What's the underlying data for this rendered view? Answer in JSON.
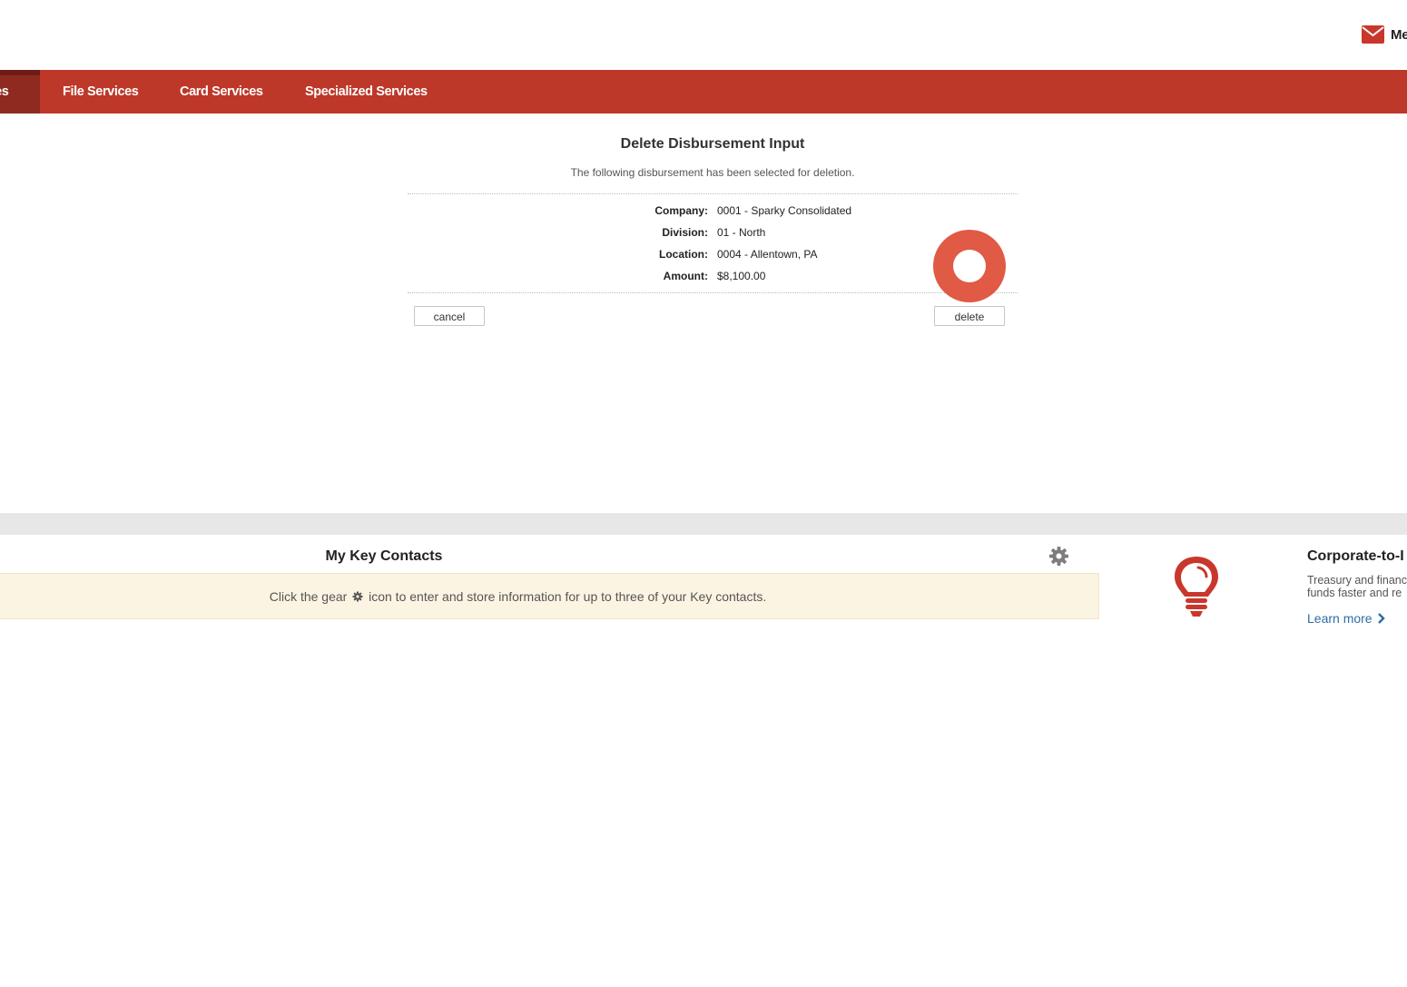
{
  "header": {
    "mail_label": "Me"
  },
  "nav": {
    "items": [
      {
        "label": "bles",
        "active": true
      },
      {
        "label": "File Services",
        "active": false
      },
      {
        "label": "Card Services",
        "active": false
      },
      {
        "label": "Specialized Services",
        "active": false
      }
    ]
  },
  "panel": {
    "title": "Delete Disbursement Input",
    "subtitle": "The following disbursement has been selected for deletion.",
    "details": [
      {
        "label": "Company:",
        "value": "0001 - Sparky Consolidated"
      },
      {
        "label": "Division:",
        "value": "01 - North"
      },
      {
        "label": "Location:",
        "value": "0004 - Allentown, PA"
      },
      {
        "label": "Amount:",
        "value": "$8,100.00"
      }
    ],
    "cancel_label": "cancel",
    "delete_label": "delete"
  },
  "key_contacts": {
    "title": "My Key Contacts",
    "message_before": "Click the gear",
    "message_after": "icon to enter and store information for up to three of your Key contacts."
  },
  "promo": {
    "title": "Corporate-to-I",
    "text_line1": "Treasury and financ",
    "text_line2": "funds faster and re",
    "link_label": "Learn more"
  },
  "colors": {
    "nav_bg": "#bd3829",
    "nav_active_bg": "#8f2a20",
    "accent_red": "#c9372c",
    "click_marker": "#e05a45",
    "notice_bg": "#fbf4e2",
    "link": "#2e6da4"
  },
  "icons": [
    "envelope-icon",
    "gear-icon",
    "lightbulb-icon",
    "chevron-right-icon"
  ]
}
